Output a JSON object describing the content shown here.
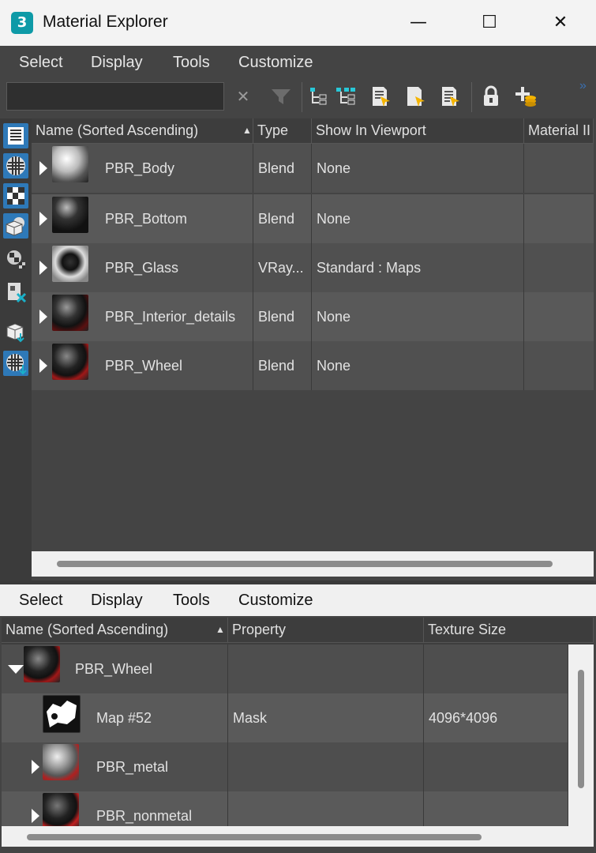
{
  "window": {
    "title": "Material Explorer",
    "icon_label": "3",
    "minimize_glyph": "—",
    "maximize_glyph": "☐",
    "close_glyph": "✕"
  },
  "top_menu": [
    "Select",
    "Display",
    "Tools",
    "Customize"
  ],
  "toolbar": {
    "search_value": "",
    "overflow_glyph": "»",
    "icons": [
      "clear-search-icon",
      "filter-icon",
      "select-children-icon",
      "select-dependents-icon",
      "select-material-icon",
      "select-object-icon",
      "select-scene-icon",
      "lock-icon",
      "add-layer-icon"
    ]
  },
  "left_tools": [
    "display-materials-icon",
    "display-maps-icon",
    "display-checker-icon",
    "display-objects-icon",
    "display-checker-small-icon",
    "display-unused-icon",
    "display-mesh-icon",
    "display-sphere-icon"
  ],
  "upper_table": {
    "columns": [
      "Name (Sorted Ascending)",
      "Type",
      "Show In Viewport",
      "Material II"
    ],
    "sort_arrow": "▲",
    "rows": [
      {
        "name": "PBR_Body",
        "type": "Blend",
        "viewport": "None"
      },
      {
        "name": "PBR_Bottom",
        "type": "Blend",
        "viewport": "None"
      },
      {
        "name": "PBR_Glass",
        "type": "VRay...",
        "viewport": "Standard : Maps"
      },
      {
        "name": "PBR_Interior_details",
        "type": "Blend",
        "viewport": "None"
      },
      {
        "name": "PBR_Wheel",
        "type": "Blend",
        "viewport": "None"
      }
    ]
  },
  "lower_menu": [
    "Select",
    "Display",
    "Tools",
    "Customize"
  ],
  "lower_table": {
    "columns": [
      "Name (Sorted Ascending)",
      "Property",
      "Texture Size"
    ],
    "sort_arrow": "▲",
    "rows": [
      {
        "name": "PBR_Wheel",
        "property": "",
        "texture": "",
        "expanded": true
      },
      {
        "name": "Map #52",
        "property": "Mask",
        "texture": "4096*4096",
        "expanded": null
      },
      {
        "name": "PBR_metal",
        "property": "",
        "texture": "",
        "expanded": false
      },
      {
        "name": "PBR_nonmetal",
        "property": "",
        "texture": "",
        "expanded": false
      }
    ]
  }
}
